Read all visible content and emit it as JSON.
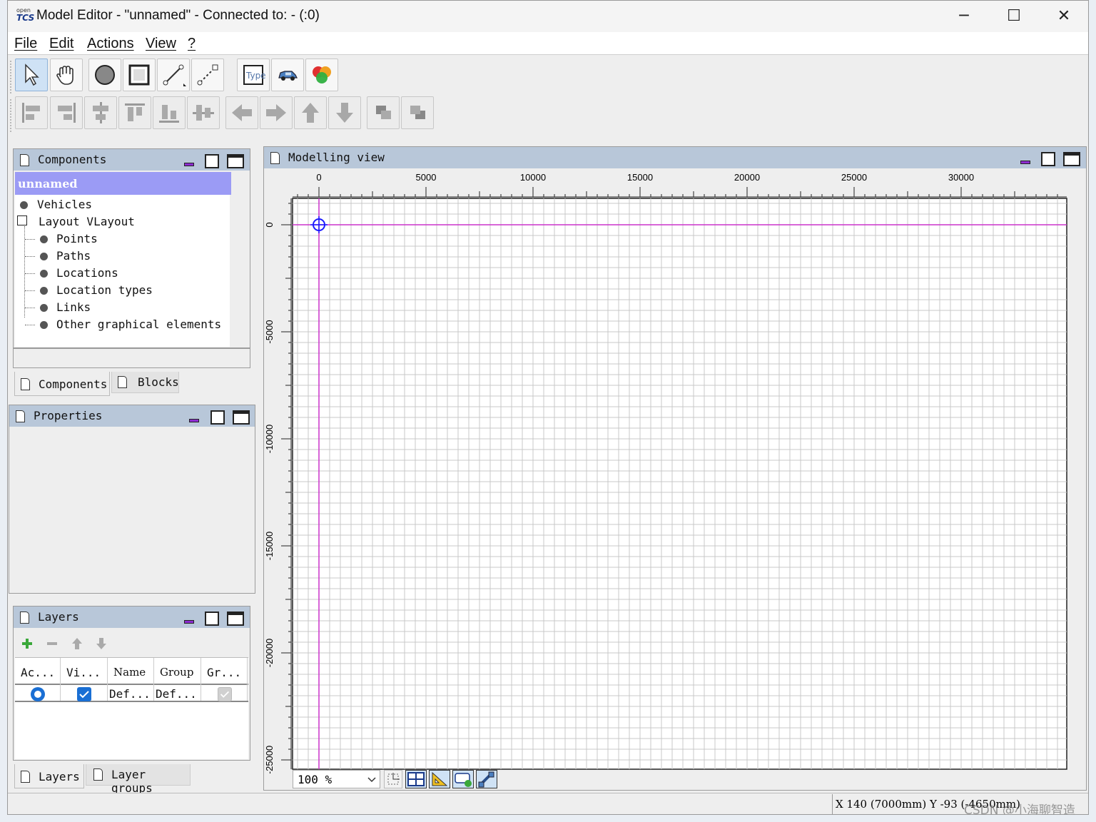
{
  "window": {
    "title": "Model Editor - \"unnamed\" - Connected to: - (:0)",
    "app_logo": "openTCS",
    "controls": {
      "minimize": "─",
      "maximize": "☐",
      "close": "✕"
    }
  },
  "menu": [
    "File",
    "Edit",
    "Actions",
    "View",
    "?"
  ],
  "toolbar_top": [
    {
      "name": "select-tool-icon",
      "selected": true
    },
    {
      "name": "drag-hand-icon"
    },
    {
      "name": "point-tool-icon"
    },
    {
      "name": "location-tool-icon"
    },
    {
      "name": "path-tool-icon"
    },
    {
      "name": "link-tool-icon"
    },
    {
      "name": "location-type-icon",
      "text": "Type"
    },
    {
      "name": "vehicle-icon"
    },
    {
      "name": "block-icon"
    }
  ],
  "toolbar_align": [
    "align-left-icon",
    "align-right-icon",
    "align-center-h-icon",
    "align-top-icon",
    "align-bottom-icon",
    "align-center-v-icon",
    "move-left-icon",
    "move-right-icon",
    "move-up-icon",
    "move-down-icon",
    "bring-front-icon",
    "send-back-icon"
  ],
  "components_panel": {
    "title": "Components",
    "model_name": "unnamed",
    "tree": {
      "vehicles": "Vehicles",
      "layout": "Layout VLayout",
      "children": [
        "Points",
        "Paths",
        "Locations",
        "Location types",
        "Links",
        "Other graphical elements"
      ]
    },
    "tabs": [
      "Components",
      "Blocks"
    ]
  },
  "properties_panel": {
    "title": "Properties"
  },
  "layers_panel": {
    "title": "Layers",
    "columns": [
      "Ac...",
      "Vi...",
      "Name",
      "Group",
      "Gr..."
    ],
    "rows": [
      {
        "active": true,
        "visible": true,
        "name": "Def...",
        "group": "Def...",
        "group_visible": true
      }
    ],
    "tabs": [
      "Layers",
      "Layer groups"
    ]
  },
  "modelling_view": {
    "title": "Modelling view",
    "x_ticks": [
      "0",
      "5000",
      "10000",
      "15000",
      "20000",
      "25000",
      "30000"
    ],
    "y_ticks": [
      "0",
      "-5000",
      "-10000",
      "-15000",
      "-20000",
      "-25000"
    ],
    "zoom": "100 %",
    "bottom_tools": [
      "snap-grid-icon",
      "grid-toggle-icon",
      "ruler-icon",
      "label-toggle-icon",
      "blocks-toggle-icon"
    ]
  },
  "status": {
    "coordinates": "X 140 (7000mm) Y -93 (-4650mm)"
  },
  "watermark": "CSDN @小海聊智造",
  "colors": {
    "panel_header": "#b8c7d9",
    "model_highlight": "#9b9bf5",
    "axis": "#cc33cc",
    "origin_marker": "#1a1aff"
  }
}
